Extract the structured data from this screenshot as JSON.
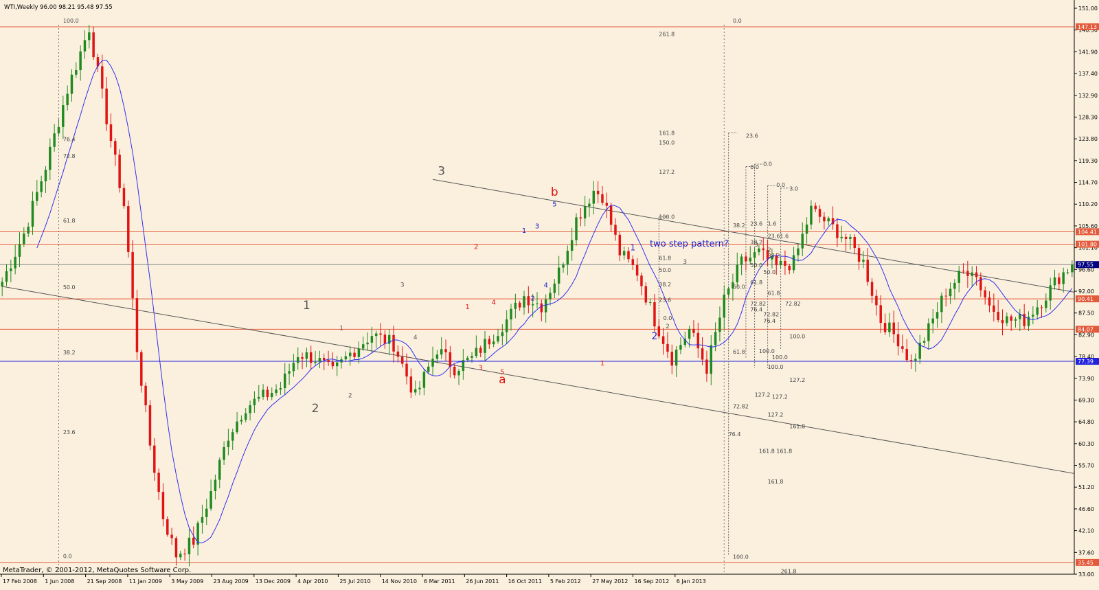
{
  "chart_data": {
    "type": "candlestick",
    "symbol_line": "WTI,Weekly  96.00 98.21 95.48 97.55",
    "copyright": "MetaTrader, © 2001-2012, MetaQuotes Software Corp.",
    "annotation_text": "two step pattern?",
    "colors": {
      "background": "#fbf0de",
      "bull": "#1f8a1f",
      "bear": "#e01414",
      "ma": "#2f2ff0",
      "hline_red": "#e35a3a",
      "hline_blue": "#2222dd",
      "trendline": "#555555",
      "fib": "#555555",
      "wave_gray": "#555555",
      "wave_red": "#e01414",
      "wave_blue": "#2222cc"
    },
    "y_axis": {
      "min": 33.0,
      "max": 151.0,
      "ticks": [
        "151.00",
        "146.30",
        "141.90",
        "137.40",
        "132.90",
        "128.30",
        "123.80",
        "119.30",
        "114.70",
        "110.20",
        "105.60",
        "101.10",
        "96.60",
        "92.00",
        "87.50",
        "82.90",
        "78.40",
        "73.90",
        "69.30",
        "64.80",
        "60.30",
        "55.70",
        "51.20",
        "46.60",
        "42.10",
        "37.60",
        "33.00"
      ]
    },
    "x_axis": {
      "ticks": [
        "17 Feb 2008",
        "1 Jun 2008",
        "21 Sep 2008",
        "11 Jan 2009",
        "3 May 2009",
        "23 Aug 2009",
        "13 Dec 2009",
        "4 Apr 2010",
        "25 Jul 2010",
        "14 Nov 2010",
        "6 Mar 2011",
        "26 Jun 2011",
        "16 Oct 2011",
        "5 Feb 2012",
        "27 May 2012",
        "16 Sep 2012",
        "6 Jan 2013"
      ]
    },
    "price_keypoints": [
      [
        0,
        94
      ],
      [
        5,
        104
      ],
      [
        10,
        118
      ],
      [
        15,
        134
      ],
      [
        20,
        147
      ],
      [
        24,
        128
      ],
      [
        28,
        110
      ],
      [
        31,
        80
      ],
      [
        34,
        60
      ],
      [
        37,
        45
      ],
      [
        40,
        37
      ],
      [
        44,
        40
      ],
      [
        48,
        50
      ],
      [
        52,
        62
      ],
      [
        56,
        68
      ],
      [
        60,
        70
      ],
      [
        64,
        72
      ],
      [
        68,
        79
      ],
      [
        72,
        78
      ],
      [
        76,
        75
      ],
      [
        80,
        79
      ],
      [
        85,
        83
      ],
      [
        90,
        81
      ],
      [
        95,
        70
      ],
      [
        100,
        80
      ],
      [
        104,
        76
      ],
      [
        108,
        78
      ],
      [
        112,
        82
      ],
      [
        116,
        86
      ],
      [
        120,
        91
      ],
      [
        124,
        89
      ],
      [
        128,
        96
      ],
      [
        132,
        107
      ],
      [
        136,
        113
      ],
      [
        138,
        112
      ],
      [
        142,
        100
      ],
      [
        146,
        96
      ],
      [
        150,
        86
      ],
      [
        154,
        78
      ],
      [
        158,
        84
      ],
      [
        162,
        76
      ],
      [
        166,
        90
      ],
      [
        170,
        98
      ],
      [
        174,
        100
      ],
      [
        178,
        97
      ],
      [
        182,
        98
      ],
      [
        186,
        109
      ],
      [
        190,
        106
      ],
      [
        194,
        103
      ],
      [
        198,
        98
      ],
      [
        202,
        86
      ],
      [
        206,
        82
      ],
      [
        209,
        77
      ],
      [
        213,
        84
      ],
      [
        217,
        92
      ],
      [
        221,
        96
      ],
      [
        223,
        97
      ],
      [
        227,
        89
      ],
      [
        231,
        86
      ],
      [
        235,
        86
      ],
      [
        239,
        90
      ],
      [
        243,
        95
      ],
      [
        246,
        97.5
      ]
    ],
    "candle_count": 247,
    "h_lines": [
      {
        "value": 147.13,
        "label": "147.13",
        "kind": "red"
      },
      {
        "value": 104.41,
        "label": "104.41",
        "kind": "red"
      },
      {
        "value": 101.8,
        "label": "101.80",
        "kind": "red"
      },
      {
        "value": 97.55,
        "label": "97.55",
        "kind": "current"
      },
      {
        "value": 90.41,
        "label": "90.41",
        "kind": "red"
      },
      {
        "value": 84.07,
        "label": "84.07",
        "kind": "red"
      },
      {
        "value": 77.39,
        "label": "77.39",
        "kind": "blue"
      },
      {
        "value": 35.45,
        "label": "35.45",
        "kind": "red"
      }
    ],
    "trendlines": [
      {
        "from": [
          0,
          93.0
        ],
        "to": [
          247,
          54.0
        ]
      },
      {
        "from": [
          99,
          115.3
        ],
        "to": [
          247,
          91.8
        ]
      }
    ],
    "vertical_dotted": [
      {
        "at": 13
      },
      {
        "at": 166
      }
    ],
    "wave_labels": [
      {
        "text": "3",
        "at": [
          101,
          116.3
        ],
        "color": "wave_gray",
        "size": 17
      },
      {
        "text": "1",
        "at": [
          70,
          88.3
        ],
        "color": "wave_gray",
        "size": 17
      },
      {
        "text": "2",
        "at": [
          72,
          66.8
        ],
        "color": "wave_gray",
        "size": 17
      },
      {
        "text": "b",
        "at": [
          127,
          111.9
        ],
        "color": "wave_red",
        "size": 17
      },
      {
        "text": "a",
        "at": [
          115,
          72.8
        ],
        "color": "wave_red",
        "size": 17
      },
      {
        "text": "1",
        "at": [
          107,
          88.3
        ],
        "color": "wave_red",
        "size": 10
      },
      {
        "text": "2",
        "at": [
          109,
          100.8
        ],
        "color": "wave_red",
        "size": 10
      },
      {
        "text": "3",
        "at": [
          110,
          75.6
        ],
        "color": "wave_red",
        "size": 10
      },
      {
        "text": "4",
        "at": [
          113,
          89.2
        ],
        "color": "wave_red",
        "size": 10
      },
      {
        "text": "5",
        "at": [
          115,
          74.7
        ],
        "color": "wave_red",
        "size": 10
      },
      {
        "text": "1",
        "at": [
          138,
          76.5
        ],
        "color": "wave_red",
        "size": 10
      },
      {
        "text": "5",
        "at": [
          127,
          109.7
        ],
        "color": "wave_blue",
        "size": 10
      },
      {
        "text": "1",
        "at": [
          120,
          104.2
        ],
        "color": "wave_blue",
        "size": 10
      },
      {
        "text": "3",
        "at": [
          123,
          105.1
        ],
        "color": "wave_blue",
        "size": 10
      },
      {
        "text": "2",
        "at": [
          122,
          90.1
        ],
        "color": "wave_blue",
        "size": 10
      },
      {
        "text": "4",
        "at": [
          125,
          92.8
        ],
        "color": "wave_blue",
        "size": 10
      },
      {
        "text": "1",
        "at": [
          145,
          100.5
        ],
        "color": "wave_blue",
        "size": 12
      },
      {
        "text": "2",
        "at": [
          150,
          82.0
        ],
        "color": "wave_blue",
        "size": 14
      },
      {
        "text": "3",
        "at": [
          92,
          92.9
        ],
        "color": "wave_gray",
        "size": 9
      },
      {
        "text": "4",
        "at": [
          95,
          82.0
        ],
        "color": "wave_gray",
        "size": 9
      },
      {
        "text": "1",
        "at": [
          78,
          83.9
        ],
        "color": "wave_gray",
        "size": 9
      },
      {
        "text": "2",
        "at": [
          80,
          69.9
        ],
        "color": "wave_gray",
        "size": 9
      },
      {
        "text": "3",
        "at": [
          157,
          97.7
        ],
        "color": "wave_gray",
        "size": 9
      },
      {
        "text": "2",
        "at": [
          153,
          84.3
        ],
        "color": "wave_gray",
        "size": 9
      }
    ],
    "fib_labels": [
      {
        "text": "100.0",
        "at": [
          14,
          148.0
        ]
      },
      {
        "text": "76.4",
        "at": [
          14,
          123.3
        ]
      },
      {
        "text": "72.8",
        "at": [
          14,
          119.8
        ]
      },
      {
        "text": "61.8",
        "at": [
          14,
          106.3
        ]
      },
      {
        "text": "50.0",
        "at": [
          14,
          92.4
        ]
      },
      {
        "text": "38.2",
        "at": [
          14,
          78.8
        ]
      },
      {
        "text": "23.6",
        "at": [
          14,
          62.2
        ]
      },
      {
        "text": "0.0",
        "at": [
          14,
          36.4
        ]
      },
      {
        "text": "261.8",
        "at": [
          151,
          145.2
        ]
      },
      {
        "text": "161.8",
        "at": [
          151,
          124.6
        ]
      },
      {
        "text": "150.0",
        "at": [
          151,
          122.6
        ]
      },
      {
        "text": "127.2",
        "at": [
          151,
          116.5
        ]
      },
      {
        "text": "100.0",
        "at": [
          151,
          107.1
        ]
      },
      {
        "text": "61.8",
        "at": [
          151,
          98.5
        ]
      },
      {
        "text": "50.0",
        "at": [
          151,
          96.0
        ]
      },
      {
        "text": "38.2",
        "at": [
          151,
          93.0
        ]
      },
      {
        "text": "23.6",
        "at": [
          151,
          89.8
        ]
      },
      {
        "text": "0.0",
        "at": [
          152,
          86.0
        ]
      },
      {
        "text": "0.0",
        "at": [
          168,
          148.0
        ]
      },
      {
        "text": "23.6",
        "at": [
          171,
          124.0
        ]
      },
      {
        "text": "38.2",
        "at": [
          168,
          105.3
        ]
      },
      {
        "text": "50.0",
        "at": [
          168,
          92.5
        ]
      },
      {
        "text": "61.8",
        "at": [
          168,
          79.0
        ]
      },
      {
        "text": "72.82",
        "at": [
          168,
          67.6
        ]
      },
      {
        "text": "76.4",
        "at": [
          167,
          61.8
        ]
      },
      {
        "text": "100.0",
        "at": [
          168,
          36.2
        ]
      },
      {
        "text": "0.0",
        "at": [
          172,
          117.5
        ]
      },
      {
        "text": "0.0",
        "at": [
          175,
          118.1
        ]
      },
      {
        "text": "0.0",
        "at": [
          178,
          113.8
        ]
      },
      {
        "text": "3.0",
        "at": [
          181,
          113.0
        ]
      },
      {
        "text": "23.6",
        "at": [
          172,
          105.7
        ]
      },
      {
        "text": "1.6",
        "at": [
          176,
          105.7
        ]
      },
      {
        "text": "23.61.6",
        "at": [
          176,
          103.1
        ]
      },
      {
        "text": "38.2",
        "at": [
          172,
          101.8
        ]
      },
      {
        "text": "50.0",
        "at": [
          172,
          97.0
        ]
      },
      {
        "text": "50.0",
        "at": [
          175,
          95.6
        ]
      },
      {
        "text": "38.2",
        "at": [
          176,
          99.0
        ]
      },
      {
        "text": "61.8",
        "at": [
          172,
          93.4
        ]
      },
      {
        "text": "61.8",
        "at": [
          176,
          91.2
        ]
      },
      {
        "text": "72.82",
        "at": [
          172,
          89.0
        ]
      },
      {
        "text": "76.4",
        "at": [
          172,
          87.8
        ]
      },
      {
        "text": "72.82",
        "at": [
          175,
          86.8
        ]
      },
      {
        "text": "76.4",
        "at": [
          175,
          85.4
        ]
      },
      {
        "text": "72.82",
        "at": [
          180,
          89.0
        ]
      },
      {
        "text": "100.0",
        "at": [
          174,
          79.1
        ]
      },
      {
        "text": "100.0",
        "at": [
          177,
          77.8
        ]
      },
      {
        "text": "100.0",
        "at": [
          181,
          82.2
        ]
      },
      {
        "text": "100.0",
        "at": [
          176,
          75.8
        ]
      },
      {
        "text": "127.2",
        "at": [
          173,
          70.0
        ]
      },
      {
        "text": "127.2",
        "at": [
          177,
          69.6
        ]
      },
      {
        "text": "127.2",
        "at": [
          181,
          73.1
        ]
      },
      {
        "text": "127.2",
        "at": [
          176,
          65.9
        ]
      },
      {
        "text": "161.8",
        "at": [
          181,
          63.4
        ]
      },
      {
        "text": "161.8",
        "at": [
          174,
          58.3
        ]
      },
      {
        "text": "161.8",
        "at": [
          178,
          58.3
        ]
      },
      {
        "text": "161.8",
        "at": [
          176,
          51.9
        ]
      },
      {
        "text": "261.8",
        "at": [
          179,
          33.2
        ]
      },
      {
        "text": "3",
        "at": [
          173,
          101.3
        ]
      },
      {
        "text": "2",
        "at": [
          176,
          100.2
        ]
      }
    ]
  }
}
